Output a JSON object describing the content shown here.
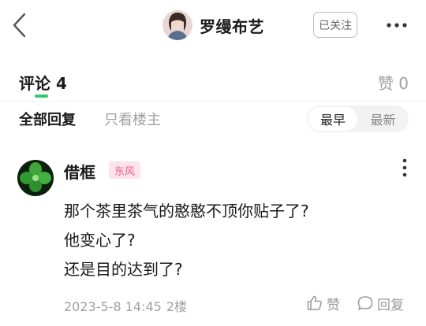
{
  "header": {
    "back_icon": "chevron-left-icon",
    "username": "罗缦布艺",
    "follow_label": "已关注",
    "more_icon": "more-horizontal-icon"
  },
  "tabs": {
    "comments_label": "评论 4",
    "likes_label": "赞 0",
    "accent_color": "#2ecc71"
  },
  "filters": {
    "all_label": "全部回复",
    "op_only_label": "只看楼主",
    "sort_earliest_label": "最早",
    "sort_latest_label": "最新",
    "active_sort": "最早"
  },
  "comment": {
    "author": "借框",
    "tag": "东风",
    "tag_color": "#ec5b86",
    "lines": [
      "那个茶里茶气的憨憨不顶你贴子了?",
      "他变心了?",
      "还是目的达到了?"
    ],
    "timestamp": "2023-5-8 14:45",
    "floor": "2楼",
    "like_label": "赞",
    "reply_label": "回复",
    "more_icon": "more-vertical-icon"
  }
}
